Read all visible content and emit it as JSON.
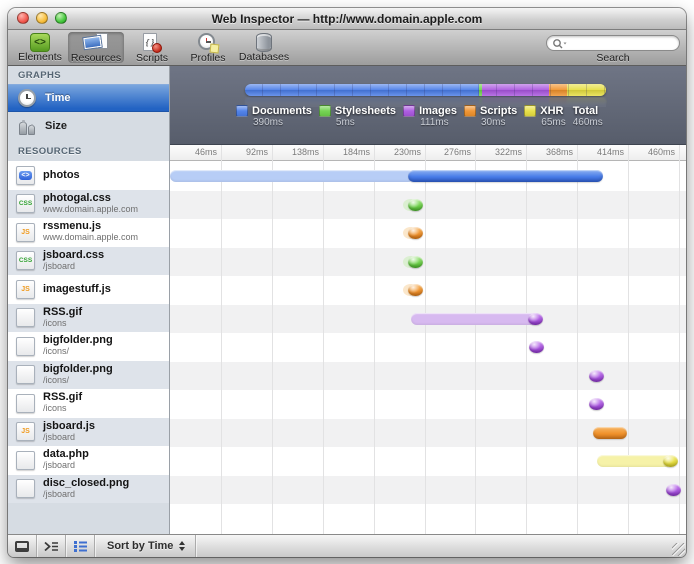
{
  "window": {
    "title": "Web Inspector — http://www.domain.apple.com"
  },
  "toolbar": {
    "buttons": [
      {
        "label": "Elements",
        "icon": "elements-icon",
        "selected": false
      },
      {
        "label": "Resources",
        "icon": "resources-icon",
        "selected": true
      },
      {
        "label": "Scripts",
        "icon": "scripts-icon",
        "selected": false
      },
      {
        "label": "Profiles",
        "icon": "profiles-icon",
        "selected": false
      },
      {
        "label": "Databases",
        "icon": "databases-icon",
        "selected": false
      }
    ],
    "search": {
      "label": "Search",
      "value": ""
    }
  },
  "sidebar": {
    "graphs_header": "GRAPHS",
    "graph_items": [
      {
        "label": "Time",
        "icon": "clock-icon",
        "selected": true
      },
      {
        "label": "Size",
        "icon": "weights-icon",
        "selected": false
      }
    ],
    "resources_header": "RESOURCES"
  },
  "chart_data": {
    "type": "timeline",
    "unit": "ms",
    "axis_ticks_ms": [
      46,
      92,
      138,
      184,
      230,
      276,
      322,
      368,
      414,
      460
    ],
    "axis_max_ms": 460,
    "categories": {
      "documents": {
        "color": "#4a7de8",
        "light": "#b7cdf6",
        "grad_hi": "#8db1f2",
        "grad_lo": "#2f5fd0"
      },
      "stylesheets": {
        "color": "#6ed14b",
        "light": "#c9ecb6",
        "grad_hi": "#a8e58a",
        "grad_lo": "#4aaf2e"
      },
      "images": {
        "color": "#aa56e0",
        "light": "#d7b9f0",
        "grad_hi": "#c98af0",
        "grad_lo": "#8a35c4"
      },
      "scripts": {
        "color": "#f0922c",
        "light": "#f8d3a0",
        "grad_hi": "#f7b768",
        "grad_lo": "#d4761a"
      },
      "xhr": {
        "color": "#e7df41",
        "light": "#f6f2a8",
        "grad_hi": "#f3ee86",
        "grad_lo": "#cfc72a"
      }
    },
    "summary_legend": [
      {
        "label": "Documents",
        "time_ms": 390,
        "category": "documents"
      },
      {
        "label": "Stylesheets",
        "time_ms": 5,
        "category": "stylesheets"
      },
      {
        "label": "Images",
        "time_ms": 111,
        "category": "images"
      },
      {
        "label": "Scripts",
        "time_ms": 30,
        "category": "scripts"
      },
      {
        "label": "XHR",
        "time_ms": 65,
        "category": "xhr"
      },
      {
        "label": "Total",
        "time_ms": 460,
        "category": null
      }
    ],
    "resources": [
      {
        "name": "photos",
        "subtitle": "",
        "icon": "html",
        "category": "documents",
        "latency_ms": [
          0,
          215
        ],
        "solid_ms": [
          215,
          391
        ]
      },
      {
        "name": "photogal.css",
        "subtitle": "www.domain.apple.com",
        "icon": "css",
        "category": "stylesheets",
        "dot_ms": 222,
        "ghost": true
      },
      {
        "name": "rssmenu.js",
        "subtitle": "www.domain.apple.com",
        "icon": "js",
        "category": "scripts",
        "dot_ms": 222,
        "ghost": true
      },
      {
        "name": "jsboard.css",
        "subtitle": "/jsboard",
        "icon": "css",
        "category": "stylesheets",
        "dot_ms": 222,
        "ghost": true
      },
      {
        "name": "imagestuff.js",
        "subtitle": "",
        "icon": "js",
        "category": "scripts",
        "dot_ms": 222,
        "ghost": true
      },
      {
        "name": "RSS.gif",
        "subtitle": "/icons",
        "icon": "plain",
        "category": "images",
        "latency_ms": [
          218,
          330
        ],
        "dot_ms": 330
      },
      {
        "name": "bigfolder.png",
        "subtitle": "/icons/",
        "icon": "plain",
        "category": "images",
        "dot_ms": 331
      },
      {
        "name": "bigfolder.png",
        "subtitle": "/icons/",
        "icon": "plain",
        "category": "images",
        "dot_ms": 385
      },
      {
        "name": "RSS.gif",
        "subtitle": "/icons",
        "icon": "plain",
        "category": "images",
        "dot_ms": 385
      },
      {
        "name": "jsboard.js",
        "subtitle": "/jsboard",
        "icon": "js",
        "category": "scripts",
        "solid_ms": [
          382,
          413
        ]
      },
      {
        "name": "data.php",
        "subtitle": "/jsboard",
        "icon": "plain",
        "category": "xhr",
        "latency_ms": [
          386,
          448
        ],
        "dot_ms": 452
      },
      {
        "name": "disc_closed.png",
        "subtitle": "/jsboard",
        "icon": "plain",
        "category": "images",
        "dot_ms": 455
      }
    ]
  },
  "statusbar": {
    "sort_label": "Sort by Time",
    "icons": [
      "dock-icon",
      "console-icon",
      "list-view-icon"
    ]
  }
}
